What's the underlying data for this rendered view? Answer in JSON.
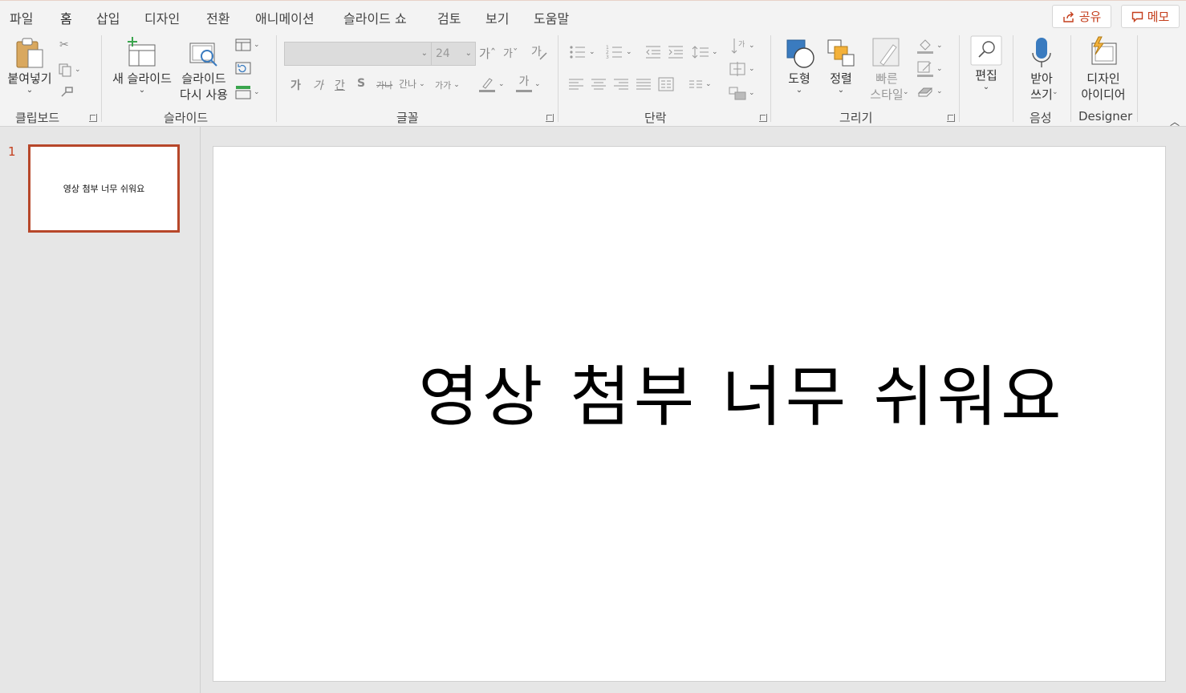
{
  "tabs": [
    "파일",
    "홈",
    "삽입",
    "디자인",
    "전환",
    "애니메이션",
    "슬라이드 쇼",
    "검토",
    "보기",
    "도움말"
  ],
  "active_tab": "홈",
  "share_label": "공유",
  "comment_label": "메모",
  "ribbon": {
    "clipboard": {
      "paste_label": "붙여넣기",
      "group_label": "클립보드"
    },
    "slides": {
      "new_slide_line1": "새 슬라이드",
      "reuse_line1": "슬라이드",
      "reuse_line2": "다시 사용",
      "group_label": "슬라이드"
    },
    "font": {
      "font_name": "",
      "font_size": "24",
      "group_label": "글꼴",
      "grow": "가ˆ",
      "shrink": "가ˇ",
      "bold": "가",
      "italic": "가",
      "underline": "간",
      "shadow": "S",
      "strike": "가나",
      "spacing": "간나",
      "case": "가가",
      "font_color": "가"
    },
    "paragraph": {
      "group_label": "단락"
    },
    "drawing": {
      "shapes_label": "도형",
      "arrange_label": "정렬",
      "quick_styles_line1": "빠른",
      "quick_styles_line2": "스타일",
      "group_label": "그리기"
    },
    "editing": {
      "label": "편집"
    },
    "voice": {
      "dictate_line1": "받아",
      "dictate_line2": "쓰기",
      "group_label": "음성"
    },
    "designer": {
      "ideas_line1": "디자인",
      "ideas_line2": "아이디어",
      "group_label": "Designer"
    }
  },
  "thumbnails": [
    {
      "number": "1",
      "text": "영상 첨부 너무 쉬워요"
    }
  ],
  "slide": {
    "title": "영상 첨부 너무 쉬워요"
  },
  "colors": {
    "accent": "#c43e1c",
    "thumb_border": "#b7472a",
    "ribbon_bg": "#f3f3f3",
    "workspace_bg": "#e6e6e6"
  }
}
